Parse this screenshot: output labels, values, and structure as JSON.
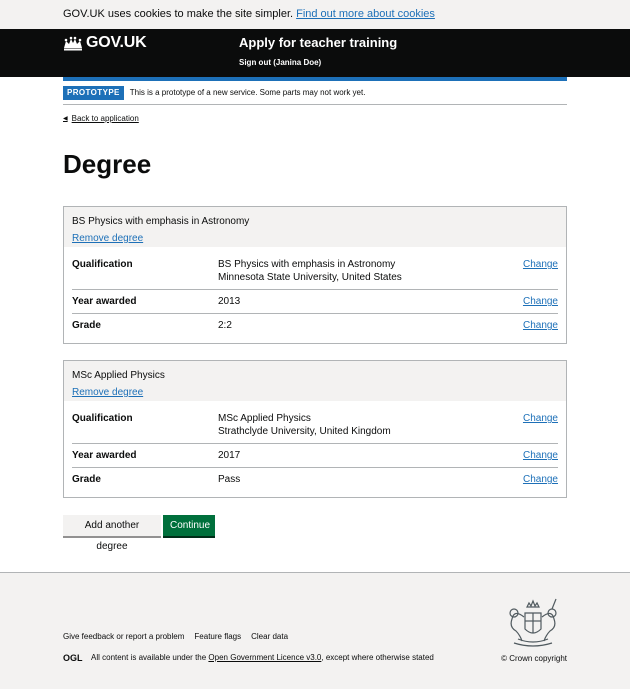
{
  "cookie_banner": {
    "text": "GOV.UK uses cookies to make the site simpler.",
    "link": "Find out more about cookies"
  },
  "header": {
    "logo_text": "GOV.UK",
    "service_name": "Apply for teacher training",
    "signout": "Sign out (Janina Doe)"
  },
  "phase_banner": {
    "tag": "PROTOTYPE",
    "text": "This is a prototype of a new service. Some parts may not work yet."
  },
  "back_link": "Back to application",
  "page_title": "Degree",
  "degrees": [
    {
      "title": "BS Physics with emphasis in Astronomy",
      "remove": "Remove degree",
      "rows": [
        {
          "key": "Qualification",
          "value": [
            "BS Physics with emphasis in Astronomy",
            "Minnesota State University, United States"
          ],
          "action": "Change"
        },
        {
          "key": "Year awarded",
          "value": [
            "2013"
          ],
          "action": "Change"
        },
        {
          "key": "Grade",
          "value": [
            "2:2"
          ],
          "action": "Change"
        }
      ]
    },
    {
      "title": "MSc Applied Physics",
      "remove": "Remove degree",
      "rows": [
        {
          "key": "Qualification",
          "value": [
            "MSc Applied Physics",
            "Strathclyde University, United Kingdom"
          ],
          "action": "Change"
        },
        {
          "key": "Year awarded",
          "value": [
            "2017"
          ],
          "action": "Change"
        },
        {
          "key": "Grade",
          "value": [
            "Pass"
          ],
          "action": "Change"
        }
      ]
    }
  ],
  "buttons": {
    "add_another": "Add another degree",
    "continue": "Continue"
  },
  "footer": {
    "links": [
      "Give feedback or report a problem",
      "Feature flags",
      "Clear data"
    ],
    "licence_prefix": "All content is available under the",
    "licence_link": "Open Government Licence v3.0",
    "licence_suffix": ", except where otherwise stated",
    "copyright": "© Crown copyright",
    "ogl_logo_text": "OGL"
  },
  "colors": {
    "link": "#1d70b8",
    "header": "#0b0c0c",
    "primary_button": "#00703c",
    "footer_bg": "#f3f2f1"
  }
}
